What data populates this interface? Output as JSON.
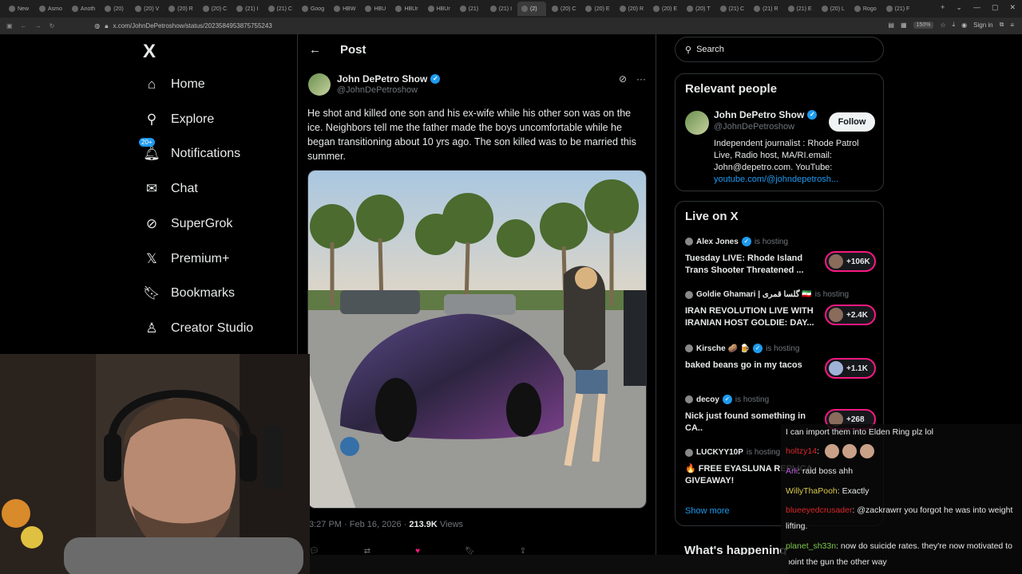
{
  "browser": {
    "tabs": [
      "New",
      "Asmo",
      "Anoth",
      "(20)",
      "(20) V",
      "(20) R",
      "(20) C",
      "(21) I",
      "(21) C",
      "Goog",
      "HBW",
      "HBU",
      "HBUr",
      "HBUr",
      "(21)",
      "(21) I",
      "(2)",
      "(20) C",
      "(20) E",
      "(20) R",
      "(20) E",
      "(20) T",
      "(21) C",
      "(21) R",
      "(21) E",
      "(20) L",
      "Rogo",
      "(21) F"
    ],
    "url": "x.com/JohnDePetroshow/status/2023584953875755243",
    "zoom": "150%",
    "sign_in": "Sign in"
  },
  "nav": {
    "logo": "X",
    "items": [
      {
        "label": "Home",
        "icon": "home-icon"
      },
      {
        "label": "Explore",
        "icon": "search-icon"
      },
      {
        "label": "Notifications",
        "icon": "bell-icon",
        "badge": "20+"
      },
      {
        "label": "Chat",
        "icon": "mail-icon"
      },
      {
        "label": "SuperGrok",
        "icon": "grok-icon"
      },
      {
        "label": "Premium+",
        "icon": "x-icon"
      },
      {
        "label": "Bookmarks",
        "icon": "bookmark-icon"
      },
      {
        "label": "Creator Studio",
        "icon": "creator-icon"
      }
    ]
  },
  "post": {
    "header_title": "Post",
    "author_name": "John DePetro Show",
    "author_handle": "@JohnDePetroshow",
    "text": "He shot and killed one son and his ex-wife while his other son was on the ice. Neighbors tell me the father made the boys uncomfortable while he began transitioning about 10 yrs ago. The son killed was to be married this summer.",
    "time": "3:27 PM · Feb 16, 2026 · ",
    "views_count": "213.9K",
    "views_label": " Views"
  },
  "right": {
    "search_placeholder": "Search",
    "relevant_title": "Relevant people",
    "person_name": "John DePetro Show",
    "person_handle": "@JohnDePetroshow",
    "follow_label": "Follow",
    "bio": "Independent journalist : Rhode Patrol Live, Radio host, MA/RI.email: John@depetro.com. YouTube: ",
    "bio_link": "youtube.com/@johndepetrosh...",
    "live_title": "Live on X",
    "live": [
      {
        "host": "Alex Jones",
        "hosting": "is hosting",
        "title": "Tuesday LIVE: Rhode Island Trans Shooter Threatened ...",
        "count": "+106K"
      },
      {
        "host": "Goldie Ghamari | گلسا قمری 🇮🇷",
        "hosting": "is hosting",
        "title": "IRAN REVOLUTION LIVE WITH IRANIAN HOST GOLDIE: DAY...",
        "count": "+2.4K"
      },
      {
        "host": "Kirsche 🥔 🍺",
        "hosting": "is hosting",
        "title": "baked beans go in my tacos",
        "count": "+1.1K"
      },
      {
        "host": "decoy",
        "hosting": "is hosting",
        "title": "Nick just found something in CA..",
        "count": "+268"
      },
      {
        "host": "LUCKYY10P",
        "hosting": "is hosting",
        "title": "🔥 FREE EYASLUNA REPLICA GIVEAWAY!",
        "count": ""
      }
    ],
    "show_more": "Show more",
    "whats_happening": "What's happening"
  },
  "chat": [
    {
      "user": "",
      "message": "I can import them into Elden Ring plz lol"
    },
    {
      "user": "holtzy14",
      "message": ""
    },
    {
      "user": "Arli",
      "message": "raid boss ahh"
    },
    {
      "user": "WillyThaPooh",
      "message": "Exactly"
    },
    {
      "user": "blueeyedcrusader",
      "message": "@zackrawrr you forgot he was into weight lifting."
    },
    {
      "user": "planet_sh33n",
      "message": "now do suicide rates. they're now motivated to point the gun the other way"
    }
  ],
  "colors": {
    "accent": "#1d9bf0",
    "live_border": "#f91880",
    "background": "#000000"
  }
}
